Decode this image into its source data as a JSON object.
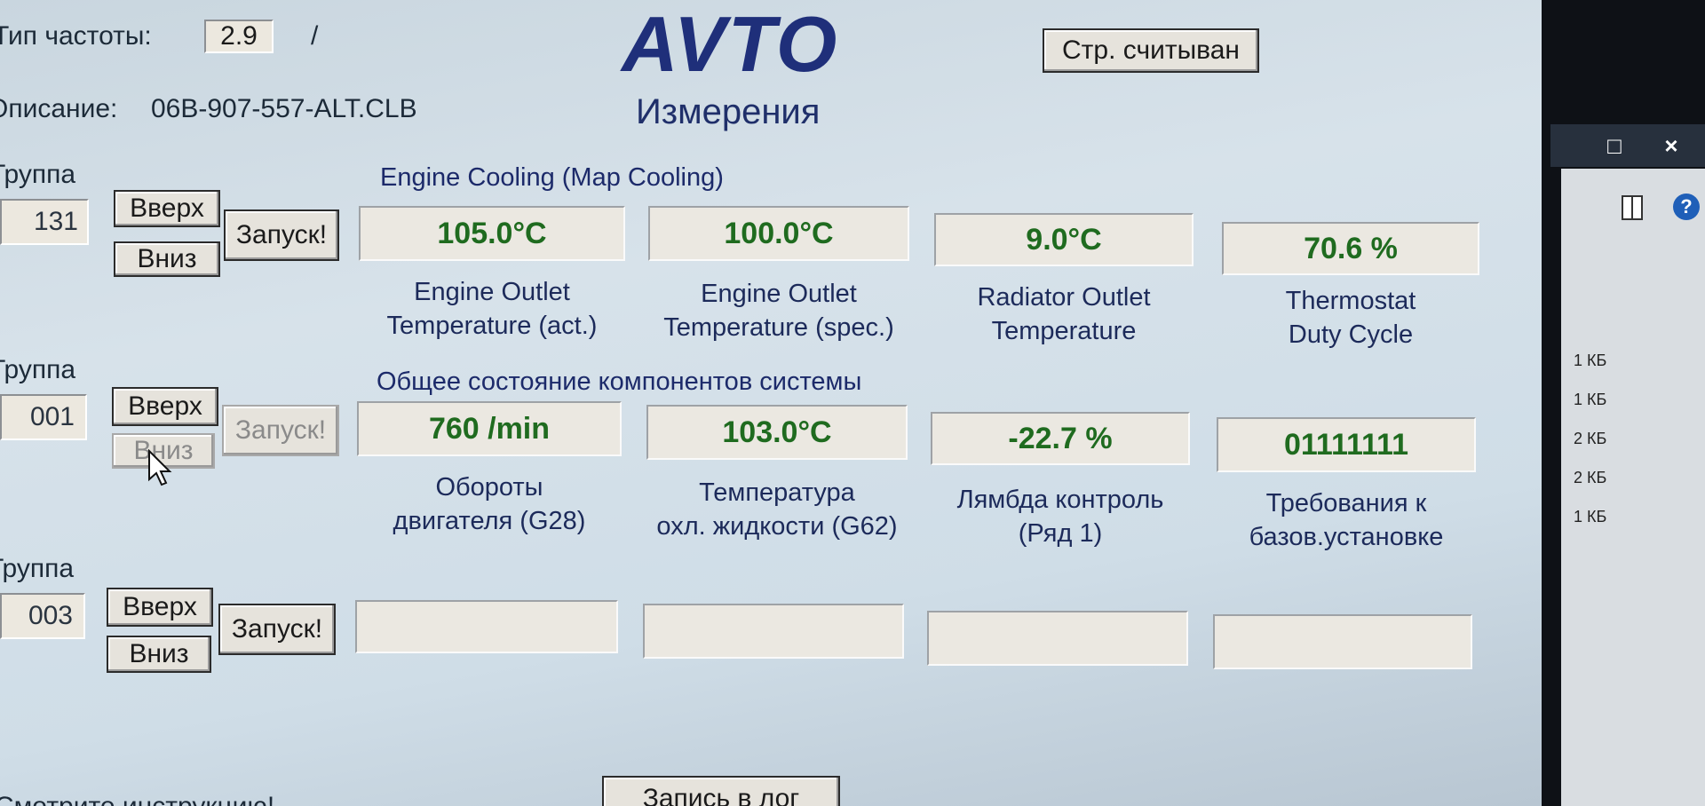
{
  "header": {
    "freq_label": "Тип частоты:",
    "freq_value": "2.9",
    "freq_sep": "/",
    "desc_label": "Описание:",
    "desc_value": "06B-907-557-ALT.CLB",
    "logo": "AVTO",
    "subtitle": "Измерения",
    "read_button": "Стр. считыван"
  },
  "groups": [
    {
      "label": "Группа",
      "number": "131",
      "up": "Вверх",
      "down": "Вниз",
      "start": "Запуск!",
      "title": "Engine Cooling (Map Cooling)",
      "fields": [
        {
          "value": "105.0°C",
          "desc1": "Engine Outlet",
          "desc2": "Temperature (act.)"
        },
        {
          "value": "100.0°C",
          "desc1": "Engine Outlet",
          "desc2": "Temperature (spec.)"
        },
        {
          "value": "9.0°C",
          "desc1": "Radiator Outlet",
          "desc2": "Temperature"
        },
        {
          "value": "70.6 %",
          "desc1": "Thermostat",
          "desc2": "Duty Cycle"
        }
      ]
    },
    {
      "label": "Группа",
      "number": "001",
      "up": "Вверх",
      "down": "Вниз",
      "start": "Запуск!",
      "title": "Общее состояние компонентов системы",
      "fields": [
        {
          "value": "760 /min",
          "desc1": "Обороты",
          "desc2": "двигателя (G28)"
        },
        {
          "value": "103.0°C",
          "desc1": "Температура",
          "desc2": "охл. жидкости (G62)"
        },
        {
          "value": "-22.7 %",
          "desc1": "Лямбда контроль",
          "desc2": "(Ряд 1)"
        },
        {
          "value": "01111111",
          "desc1": "Требования к",
          "desc2": "базов.установке"
        }
      ]
    },
    {
      "label": "Группа",
      "number": "003",
      "up": "Вверх",
      "down": "Вниз",
      "start": "Запуск!",
      "title": "",
      "fields": [
        {
          "value": ""
        },
        {
          "value": ""
        },
        {
          "value": ""
        },
        {
          "value": ""
        }
      ]
    }
  ],
  "footer": {
    "note": "Смотрите инструкцию!",
    "log_button": "Запись в лог"
  },
  "side_window": {
    "maximize_glyph": "□",
    "close_glyph": "×",
    "help_glyph": "?",
    "sizes": [
      "1 КБ",
      "1 КБ",
      "2 КБ",
      "2 КБ",
      "1 КБ"
    ]
  }
}
